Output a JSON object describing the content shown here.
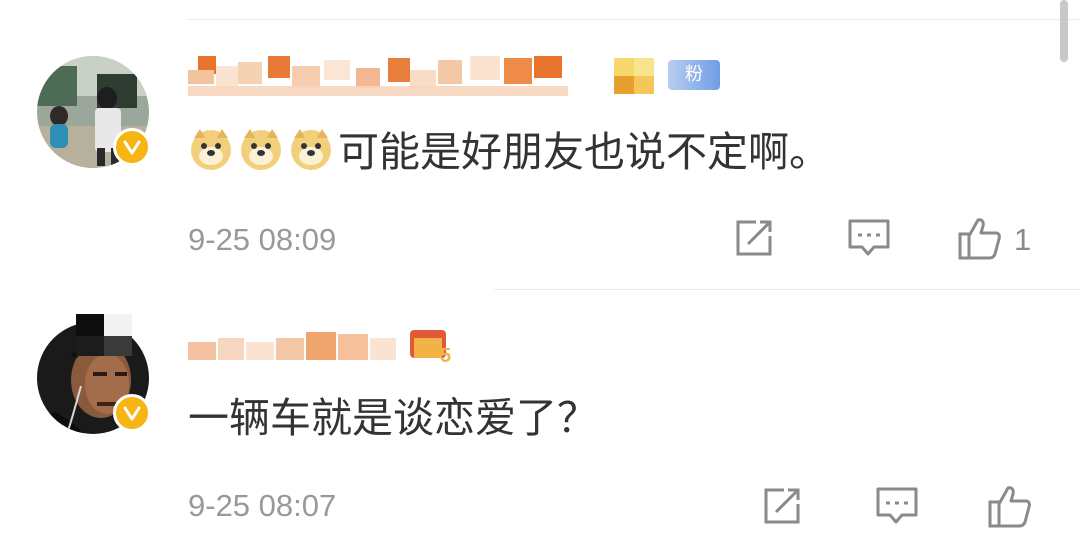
{
  "comments": [
    {
      "fan_badge": "粉",
      "emoji_icon": "doge-emoji-icon",
      "emoji_count": 3,
      "text": "可能是好朋友也说不定啊。",
      "time": "9-25 08:09",
      "like_count": "1",
      "actions": [
        "repost-icon",
        "comment-icon",
        "like-icon"
      ]
    },
    {
      "level_badge": "5",
      "text": "一辆车就是谈恋爱了？",
      "time": "9-25 08:07",
      "actions": [
        "repost-icon",
        "comment-icon",
        "like-icon"
      ]
    }
  ],
  "colors": {
    "verified_badge": "#f7b514",
    "text": "#333333",
    "meta": "#999999",
    "icon": "#8a8a8a"
  }
}
